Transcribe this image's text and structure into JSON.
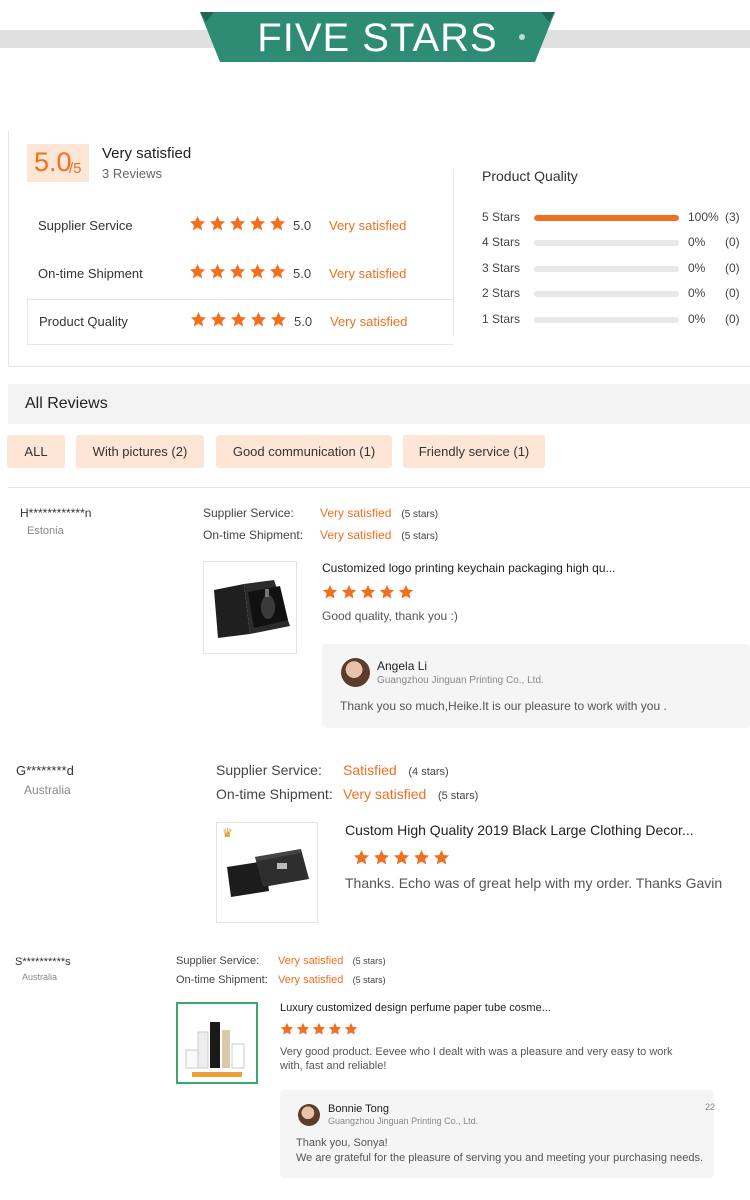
{
  "banner": {
    "title": "FIVE STARS",
    "color": "#2e8c74"
  },
  "summary": {
    "score": "5.0",
    "out_of": "/5",
    "title": "Very satisfied",
    "review_count": "3 Reviews",
    "metrics": [
      {
        "label": "Supplier Service",
        "stars": 5,
        "score": "5.0",
        "text": "Very satisfied"
      },
      {
        "label": "On-time Shipment",
        "stars": 5,
        "score": "5.0",
        "text": "Very satisfied"
      },
      {
        "label": "Product Quality",
        "stars": 5,
        "score": "5.0",
        "text": "Very satisfied"
      }
    ],
    "distribution_title": "Product Quality",
    "distribution": [
      {
        "label": "5  Stars",
        "fraction": 1.0,
        "pct": "100%",
        "count": "(3)"
      },
      {
        "label": "4  Stars",
        "fraction": 0,
        "pct": "0%",
        "count": "(0)"
      },
      {
        "label": "3  Stars",
        "fraction": 0,
        "pct": "0%",
        "count": "(0)"
      },
      {
        "label": "2  Stars",
        "fraction": 0,
        "pct": "0%",
        "count": "(0)"
      },
      {
        "label": "1  Stars",
        "fraction": 0,
        "pct": "0%",
        "count": "(0)"
      }
    ]
  },
  "all_reviews": {
    "title": "All Reviews",
    "filters": [
      "ALL",
      "With pictures (2)",
      "Good communication (1)",
      "Friendly service (1)"
    ]
  },
  "reviews": [
    {
      "name": "H************n",
      "country": "Estonia",
      "supplier_label": "Supplier Service:",
      "supplier_value": "Very satisfied",
      "supplier_stars": "(5 stars)",
      "shipment_label": "On-time Shipment:",
      "shipment_value": "Very satisfied",
      "shipment_stars": "(5 stars)",
      "product": "Customized logo printing keychain packaging high qu...",
      "rating": 5,
      "comment": "Good quality, thank you :)",
      "reply": {
        "name": "Angela Li",
        "company": "Guangzhou Jinguan Printing Co., Ltd.",
        "text": "Thank you so much,Heike.It is our pleasure to work with you ."
      }
    },
    {
      "name": "G********d",
      "country": "Australia",
      "supplier_label": "Supplier Service:",
      "supplier_value": "Satisfied",
      "supplier_stars": "(4 stars)",
      "shipment_label": "On-time Shipment:",
      "shipment_value": "Very satisfied",
      "shipment_stars": "(5 stars)",
      "product": "Custom High Quality 2019 Black Large Clothing Decor...",
      "rating": 5,
      "comment": "Thanks. Echo was of great help with my order. Thanks Gavin"
    },
    {
      "name": "S**********s",
      "country": "Australia",
      "supplier_label": "Supplier Service:",
      "supplier_value": "Very satisfied",
      "supplier_stars": "(5 stars)",
      "shipment_label": "On-time Shipment:",
      "shipment_value": "Very satisfied",
      "shipment_stars": "(5 stars)",
      "product": "Luxury customized design perfume paper tube cosme...",
      "rating": 5,
      "comment": "Very good product.  Eevee who I dealt with was a pleasure and very easy to work with, fast and reliable!",
      "reply": {
        "name": "Bonnie Tong",
        "company": "Guangzhou Jinguan Printing Co., Ltd.",
        "text_line1": "Thank you, Sonya!",
        "text_line2": "We are grateful for the pleasure of serving you and meeting your purchasing needs.",
        "date_partial": "22"
      }
    }
  ],
  "colors": {
    "accent": "#f07020",
    "badge_bg": "#fde6d6",
    "banner": "#2e8c74"
  },
  "icons": {
    "star": "star-icon",
    "crown": "crown-icon"
  }
}
